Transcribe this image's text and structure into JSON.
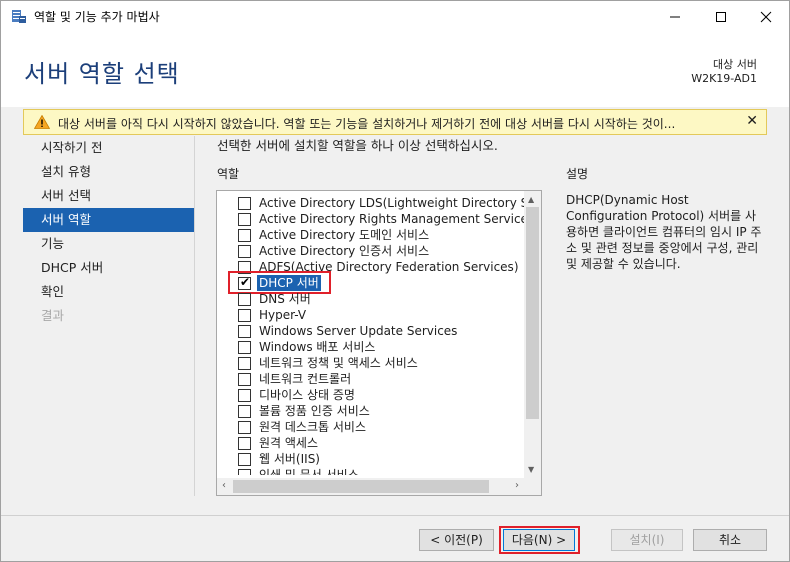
{
  "window": {
    "title": "역할 및 기능 추가 마법사",
    "minimize_glyph": "─",
    "maximize_glyph": "☐",
    "close_glyph": "✕"
  },
  "header": {
    "title": "서버 역할 선택",
    "target_label": "대상 서버",
    "target_name": "W2K19-AD1"
  },
  "warning": {
    "icon": "warning-triangle-icon",
    "text": "대상 서버를 아직 다시 시작하지 않았습니다. 역할 또는 기능을 설치하거나 제거하기 전에 대상 서버를 다시 시작하는 것이...",
    "close_glyph": "✕"
  },
  "nav": {
    "items": [
      {
        "label": "시작하기 전",
        "state": "normal"
      },
      {
        "label": "설치 유형",
        "state": "normal"
      },
      {
        "label": "서버 선택",
        "state": "normal"
      },
      {
        "label": "서버 역할",
        "state": "active"
      },
      {
        "label": "기능",
        "state": "normal"
      },
      {
        "label": "DHCP 서버",
        "state": "normal"
      },
      {
        "label": "확인",
        "state": "normal"
      },
      {
        "label": "결과",
        "state": "disabled"
      }
    ]
  },
  "main": {
    "instruction": "선택한 서버에 설치할 역할을 하나 이상 선택하십시오.",
    "roles_heading": "역할",
    "description_heading": "설명",
    "description": "DHCP(Dynamic Host Configuration Protocol) 서버를 사용하면 클라이언트 컴퓨터의 임시 IP 주소 및 관련 정보를 중앙에서 구성, 관리 및 제공할 수 있습니다."
  },
  "roles": [
    {
      "label": "Active Directory LDS(Lightweight Directory Services)",
      "checked": false,
      "selected": false
    },
    {
      "label": "Active Directory Rights Management Services",
      "checked": false,
      "selected": false
    },
    {
      "label": "Active Directory 도메인 서비스",
      "checked": false,
      "selected": false
    },
    {
      "label": "Active Directory 인증서 서비스",
      "checked": false,
      "selected": false
    },
    {
      "label": "ADFS(Active Directory Federation Services)",
      "checked": false,
      "selected": false
    },
    {
      "label": "DHCP 서버",
      "checked": true,
      "selected": true
    },
    {
      "label": "DNS 서버",
      "checked": false,
      "selected": false
    },
    {
      "label": "Hyper-V",
      "checked": false,
      "selected": false
    },
    {
      "label": "Windows Server Update Services",
      "checked": false,
      "selected": false
    },
    {
      "label": "Windows 배포 서비스",
      "checked": false,
      "selected": false
    },
    {
      "label": "네트워크 정책 및 액세스 서비스",
      "checked": false,
      "selected": false
    },
    {
      "label": "네트워크 컨트롤러",
      "checked": false,
      "selected": false
    },
    {
      "label": "디바이스 상태 증명",
      "checked": false,
      "selected": false
    },
    {
      "label": "볼륨 정품 인증 서비스",
      "checked": false,
      "selected": false
    },
    {
      "label": "원격 데스크톱 서비스",
      "checked": false,
      "selected": false
    },
    {
      "label": "원격 액세스",
      "checked": false,
      "selected": false
    },
    {
      "label": "웹 서버(IIS)",
      "checked": false,
      "selected": false
    },
    {
      "label": "인쇄 및 문서 서비스",
      "checked": false,
      "selected": false
    }
  ],
  "buttons": {
    "prev": "< 이전(P)",
    "next": "다음(N) >",
    "install": "설치(I)",
    "cancel": "취소"
  },
  "colors": {
    "accent": "#1b62b0",
    "title": "#1c3f7a",
    "warning_bg": "#fdf8c4",
    "highlight": "#e0202a"
  }
}
